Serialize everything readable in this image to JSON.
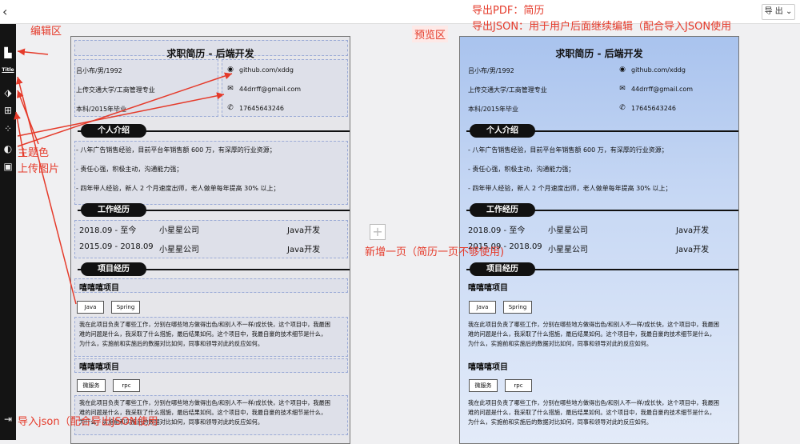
{
  "topbar": {
    "back_icon": "chevron-left-icon",
    "export_label": "导 出 ⌄"
  },
  "sidebar": {
    "title_label": "Title"
  },
  "annotations": {
    "export_pdf": "导出PDF：简历",
    "export_json": "导出JSON：用于用户后面继续编辑（配合导入JSON使用",
    "edit_area": "编辑区",
    "preview_area": "预览区",
    "theme_color": "主题色",
    "upload_image": "上传图片",
    "add_page": "新增一页（简历一页不够使用)",
    "import_json": "导入json（配合导出JSON使用"
  },
  "resume": {
    "title": "求职简历 - 后端开发",
    "info_left": [
      "吕小布/男/1992",
      "上传交通大学/工商管理专业",
      "本科/2015年毕业"
    ],
    "info_right": [
      "github.com/xddg",
      "44drrff@gmail.com",
      "17645643246"
    ],
    "sections": {
      "intro": "个人介绍",
      "work": "工作经历",
      "projects": "项目经历"
    },
    "intro_items": [
      "- 八年广告销售经验，目前平台年销售额 600 万，有深厚的行业资源；",
      "- 责任心强，积极主动，沟通能力强；",
      "- 四年带人经验，新人 2 个月速度出师，老人做单每年提高 30% 以上；"
    ],
    "work": [
      {
        "date": "2018.09 - 至今",
        "company": "小星星公司",
        "role": "Java开发"
      },
      {
        "date": "2015.09 - 2018.09",
        "company": "小星星公司",
        "role": "Java开发"
      }
    ],
    "projects": [
      {
        "name": "嘻嘻嘻项目",
        "tags": [
          "Java",
          "Spring"
        ],
        "desc": [
          "我在此项目负责了哪些工作，分别在哪些地方做得出色/和别人不一样/成长快，这个项目中，我最困",
          "难的问题是什么，我采取了什么措施，最后结果如何。这个项目中，我最自豪的技术细节是什么，",
          "为什么，实施前和实施后的数据对比如何，同事和领导对此的反应如何。"
        ]
      },
      {
        "name": "嘻嘻嘻项目",
        "tags": [
          "微服务",
          "rpc"
        ],
        "desc": [
          "我在此项目负责了哪些工作，分别在哪些地方做得出色/和别人不一样/成长快，这个项目中，我最困",
          "难的问题是什么，我采取了什么措施，最后结果如何。这个项目中，我最自豪的技术细节是什么，",
          "为什么，实施前和实施后的数据对比如何，同事和领导对此的反应如何。"
        ]
      }
    ]
  },
  "colors": {
    "annotation": "#e53a2a",
    "sidebar_bg": "#141414",
    "preview_bg": "#a9c3ee"
  }
}
